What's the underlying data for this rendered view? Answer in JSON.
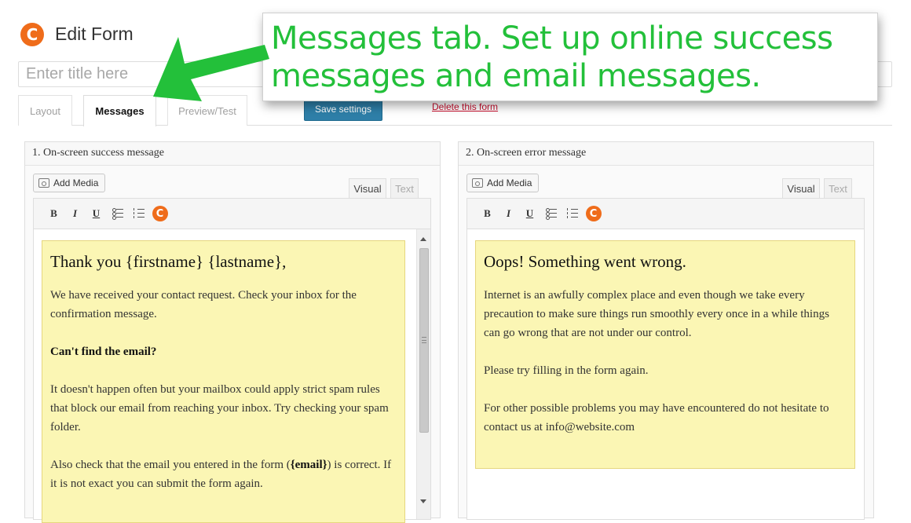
{
  "header": {
    "logo_letter": "C",
    "title": "Edit Form",
    "title_placeholder": "Enter title here"
  },
  "tabs": [
    {
      "label": "Layout",
      "active": false
    },
    {
      "label": "Messages",
      "active": true
    },
    {
      "label": "Preview/Test",
      "active": false
    }
  ],
  "actions": {
    "save_label": "Save settings",
    "delete_label": "Delete this form"
  },
  "callout": {
    "line1": "Messages tab. Set up online success",
    "line2": "messages and email messages."
  },
  "toolbar": {
    "bold": "B",
    "italic": "I",
    "underline": "U",
    "plugin_letter": "C"
  },
  "panels": {
    "success": {
      "title": "1. On-screen success message",
      "add_media_label": "Add Media",
      "visual_tab": "Visual",
      "text_tab": "Text",
      "heading": "Thank you {firstname} {lastname},",
      "p1": "We have received your contact request. Check your inbox for the confirmation message.",
      "subheading": "Can't find the email?",
      "p2": "It doesn't happen often but your mailbox could apply strict spam rules that block our email from reaching your inbox. Try checking your spam folder.",
      "p3_before": "Also check that the email you entered in the form (",
      "p3_var": "{email}",
      "p3_after": ") is correct. If it is not exact you can submit the form again."
    },
    "error": {
      "title": "2. On-screen error message",
      "add_media_label": "Add Media",
      "visual_tab": "Visual",
      "text_tab": "Text",
      "heading": "Oops! Something went wrong.",
      "p1": "Internet is an awfully complex place and even though we take every precaution to make sure things run smoothly every once in a while things can go wrong that are not under our control.",
      "p2": "Please try filling in the form again.",
      "p3": "For other possible problems you may have encountered do not hesitate to contact us at info@website.com"
    }
  },
  "colors": {
    "accent_orange": "#ef6c1a",
    "callout_green": "#23c03a",
    "save_blue": "#2e7fa8",
    "editor_yellow": "#fbf6b4"
  }
}
